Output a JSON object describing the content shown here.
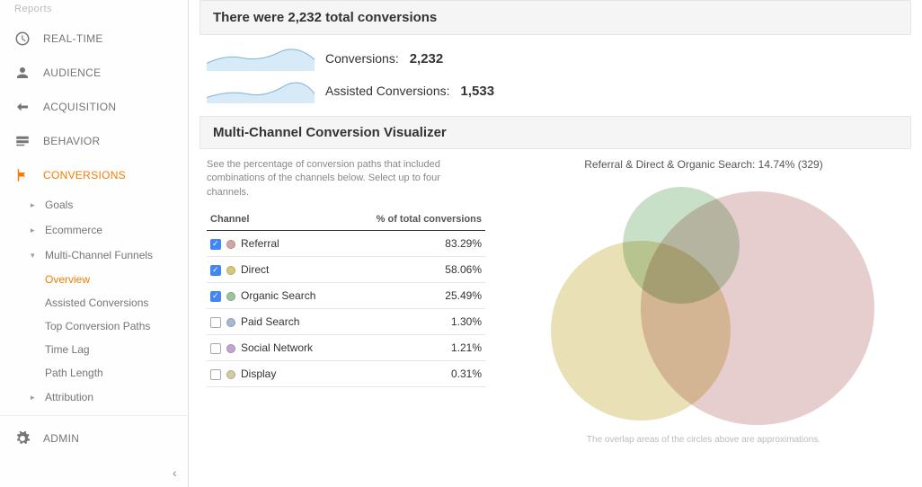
{
  "sidebar": {
    "reports_label": "Reports",
    "items": [
      {
        "label": "REAL-TIME"
      },
      {
        "label": "AUDIENCE"
      },
      {
        "label": "ACQUISITION"
      },
      {
        "label": "BEHAVIOR"
      },
      {
        "label": "CONVERSIONS"
      }
    ],
    "conversions_sub": [
      {
        "label": "Goals"
      },
      {
        "label": "Ecommerce"
      },
      {
        "label": "Multi-Channel Funnels"
      },
      {
        "label": "Attribution"
      }
    ],
    "mcf_sub": [
      {
        "label": "Overview"
      },
      {
        "label": "Assisted Conversions"
      },
      {
        "label": "Top Conversion Paths"
      },
      {
        "label": "Time Lag"
      },
      {
        "label": "Path Length"
      }
    ],
    "admin_label": "ADMIN"
  },
  "summary": {
    "headline": "There were 2,232 total conversions",
    "conv_label": "Conversions:",
    "conv_value": "2,232",
    "assist_label": "Assisted Conversions:",
    "assist_value": "1,533"
  },
  "visualizer": {
    "title": "Multi-Channel Conversion Visualizer",
    "hint": "See the percentage of conversion paths that included combinations of the channels below. Select up to four channels.",
    "col_channel": "Channel",
    "col_pct": "% of total conversions",
    "rows": [
      {
        "checked": true,
        "color": "#d4a5a5",
        "name": "Referral",
        "pct": "83.29%"
      },
      {
        "checked": true,
        "color": "#d6c77a",
        "name": "Direct",
        "pct": "58.06%"
      },
      {
        "checked": true,
        "color": "#9bc49b",
        "name": "Organic Search",
        "pct": "25.49%"
      },
      {
        "checked": false,
        "color": "#a5b8d4",
        "name": "Paid Search",
        "pct": "1.30%"
      },
      {
        "checked": false,
        "color": "#c0a5d4",
        "name": "Social Network",
        "pct": "1.21%"
      },
      {
        "checked": false,
        "color": "#d4c9a5",
        "name": "Display",
        "pct": "0.31%"
      }
    ],
    "venn_title": "Referral & Direct & Organic Search: 14.74% (329)",
    "footnote": "The overlap areas of the circles above are approximations."
  },
  "chart_data": {
    "type": "table",
    "title": "Multi-Channel Conversion Visualizer",
    "categories": [
      "Referral",
      "Direct",
      "Organic Search",
      "Paid Search",
      "Social Network",
      "Display"
    ],
    "values": [
      83.29,
      58.06,
      25.49,
      1.3,
      1.21,
      0.31
    ],
    "ylabel": "% of total conversions",
    "intersection": {
      "labels": [
        "Referral",
        "Direct",
        "Organic Search"
      ],
      "percent": 14.74,
      "count": 329
    },
    "totals": {
      "conversions": 2232,
      "assisted_conversions": 1533
    }
  }
}
